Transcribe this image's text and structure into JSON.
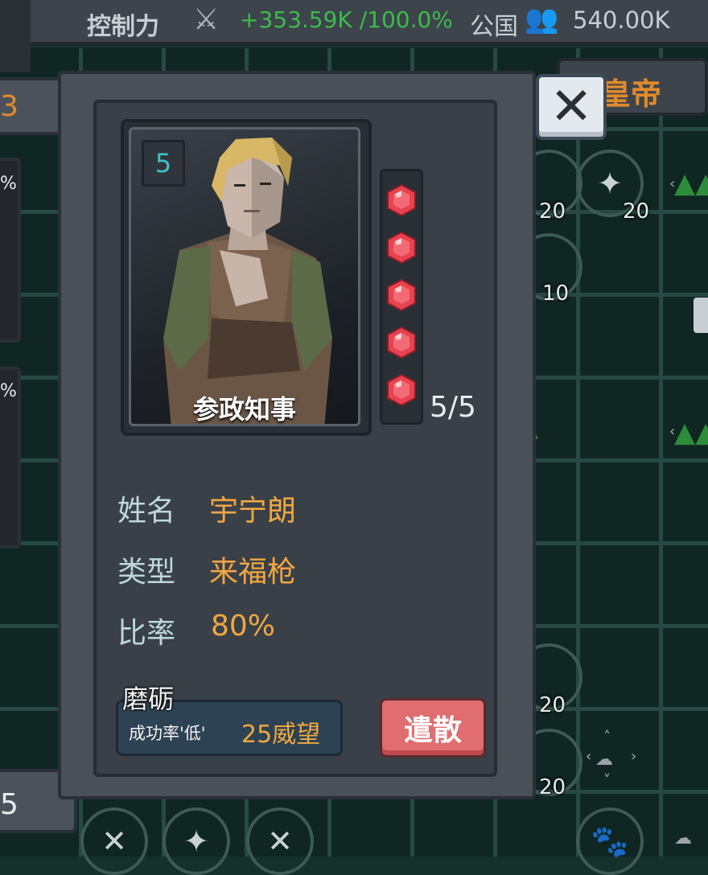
{
  "topbar": {
    "control_label": "控制力",
    "control_value": "+353.59K /100.0%",
    "rank_label": "公国",
    "population": "540.00K"
  },
  "emperor_tab": {
    "label": "皇帝"
  },
  "left_panel": {
    "top_digit": "3",
    "pct_1": "%",
    "pct_2": "%",
    "bottom_digit": "5"
  },
  "card": {
    "level": "5",
    "title": "参政知事",
    "gems_filled": 5,
    "gems_total": 5,
    "gem_count_text": "5/5"
  },
  "info": {
    "name_label": "姓名",
    "name_value": "宇宁朗",
    "type_label": "类型",
    "type_value": "来福枪",
    "rate_label": "比率",
    "rate_value": "80%"
  },
  "sharpen": {
    "title": "磨砺",
    "success_rate": "成功率'低'",
    "cost": "25威望"
  },
  "dismiss_label": "遣散",
  "map_tiles": {
    "n1": "20",
    "n2": "20",
    "n3": "10",
    "n4": "20",
    "n5": "20"
  },
  "colors": {
    "accent": "#f0a743",
    "gem": "#e8414f",
    "teal": "#3fc0c9"
  },
  "icons": [
    "close-icon",
    "crossed-swords-icon",
    "people-icon",
    "gem-icon",
    "axe-star-icon",
    "horse-icon",
    "tree-icon",
    "sheep-icon"
  ]
}
